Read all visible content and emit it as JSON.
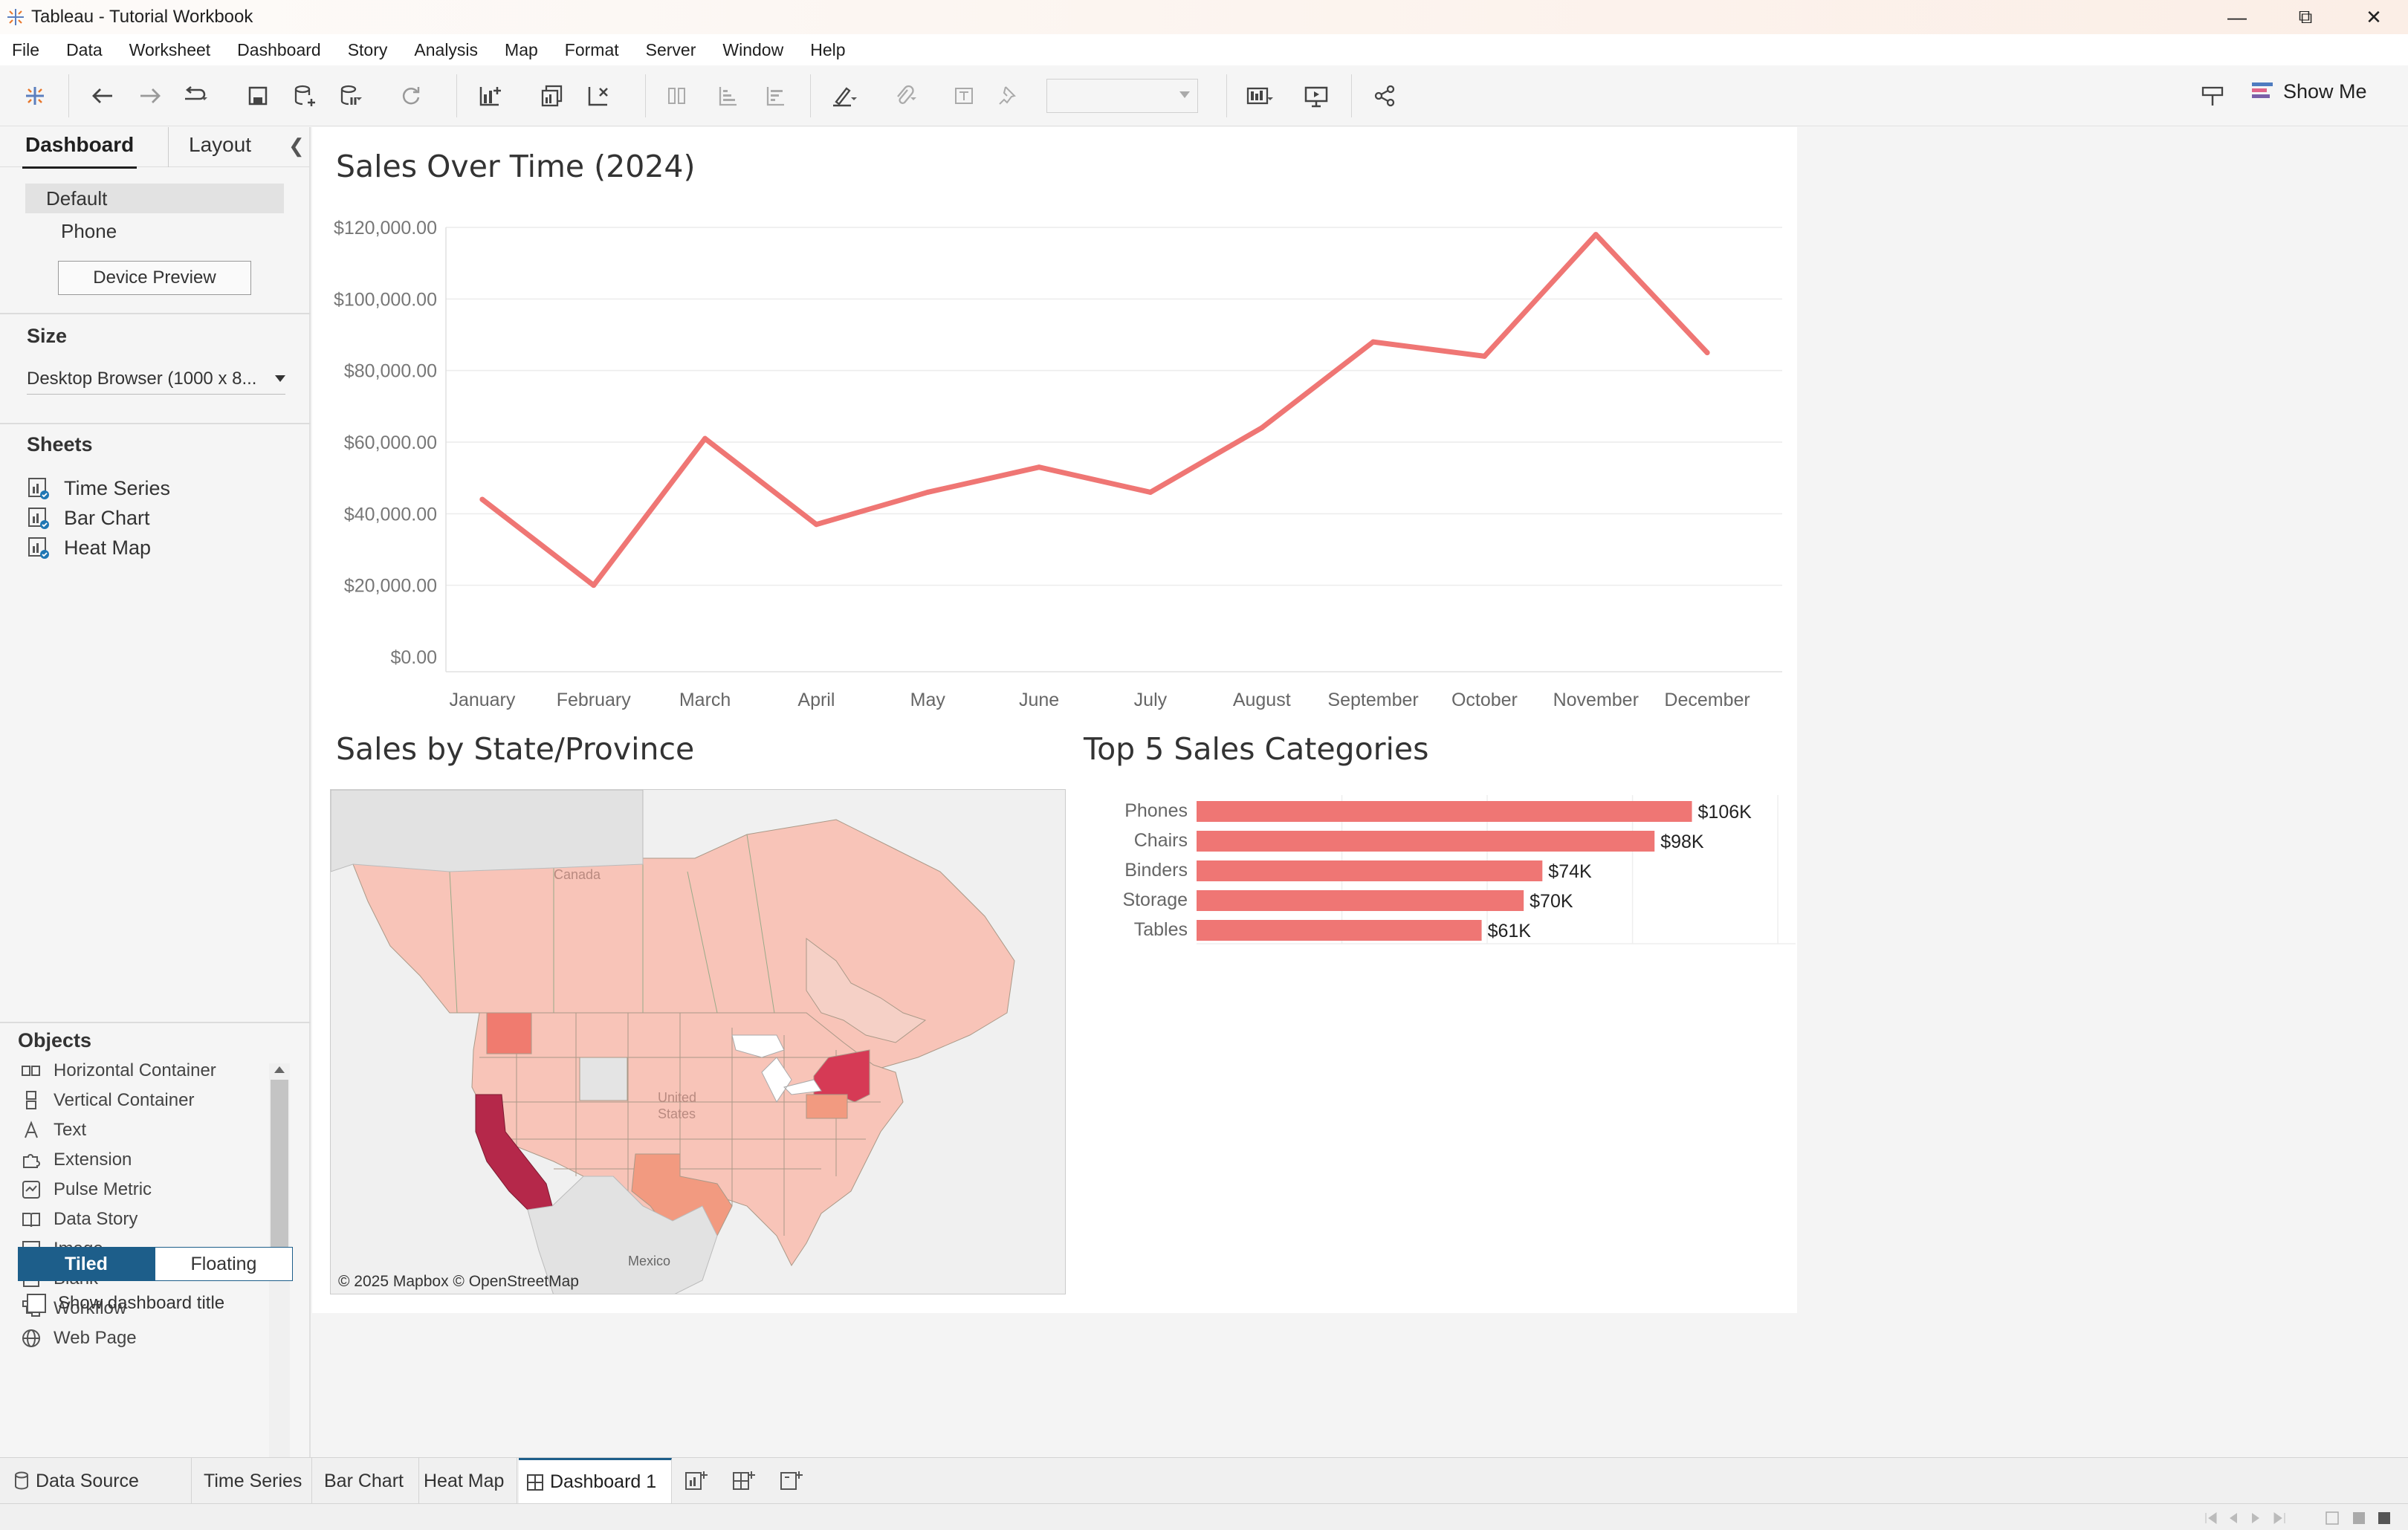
{
  "window": {
    "title": "Tableau - Tutorial Workbook"
  },
  "menu": [
    "File",
    "Data",
    "Worksheet",
    "Dashboard",
    "Story",
    "Analysis",
    "Map",
    "Format",
    "Server",
    "Window",
    "Help"
  ],
  "toolbar": {
    "show_me": "Show Me"
  },
  "left_panel": {
    "tabs": {
      "dashboard": "Dashboard",
      "layout": "Layout"
    },
    "devices": {
      "default": "Default",
      "phone": "Phone",
      "preview_button": "Device Preview"
    },
    "size": {
      "heading": "Size",
      "value": "Desktop Browser (1000 x 8..."
    },
    "sheets": {
      "heading": "Sheets",
      "items": [
        "Time Series",
        "Bar Chart",
        "Heat Map"
      ]
    },
    "objects": {
      "heading": "Objects",
      "items": [
        "Horizontal Container",
        "Vertical Container",
        "Text",
        "Extension",
        "Pulse Metric",
        "Data Story",
        "Image",
        "Blank",
        "Workflow",
        "Web Page"
      ]
    },
    "layout_mode": {
      "tiled": "Tiled",
      "floating": "Floating"
    },
    "show_title": "Show dashboard title"
  },
  "dashboard": {
    "line_title": "Sales Over Time (2024)",
    "map_title": "Sales by State/Province",
    "bar_title": "Top 5 Sales Categories",
    "map_labels": {
      "canada": "Canada",
      "usa_line1": "United",
      "usa_line2": "States",
      "mexico": "Mexico"
    },
    "map_credit": "© 2025 Mapbox © OpenStreetMap"
  },
  "chart_data": [
    {
      "type": "line",
      "title": "Sales Over Time (2024)",
      "categories": [
        "January",
        "February",
        "March",
        "April",
        "May",
        "June",
        "July",
        "August",
        "September",
        "October",
        "November",
        "December"
      ],
      "values": [
        44000,
        20000,
        61000,
        37000,
        46000,
        53000,
        46000,
        64000,
        88000,
        84000,
        118000,
        85000
      ],
      "yticks": [
        "$0.00",
        "$20,000.00",
        "$40,000.00",
        "$60,000.00",
        "$80,000.00",
        "$100,000.00",
        "$120,000.00"
      ],
      "ylim": [
        0,
        120000
      ],
      "color": "#ef7674",
      "grid": true
    },
    {
      "type": "bar",
      "title": "Top 5 Sales Categories",
      "orientation": "horizontal",
      "categories": [
        "Phones",
        "Chairs",
        "Binders",
        "Storage",
        "Tables"
      ],
      "values": [
        106,
        98,
        74,
        70,
        61
      ],
      "labels": [
        "$106K",
        "$98K",
        "$74K",
        "$70K",
        "$61K"
      ],
      "xlim": [
        0,
        125
      ],
      "color": "#ef7674"
    }
  ],
  "bottom_tabs": [
    "Data Source",
    "Time Series",
    "Bar Chart",
    "Heat Map",
    "Dashboard 1"
  ],
  "colors": {
    "accent": "#1d5e8a",
    "series": "#ef7674",
    "map_low": "#f8c4b8",
    "map_high": "#b5284a"
  }
}
